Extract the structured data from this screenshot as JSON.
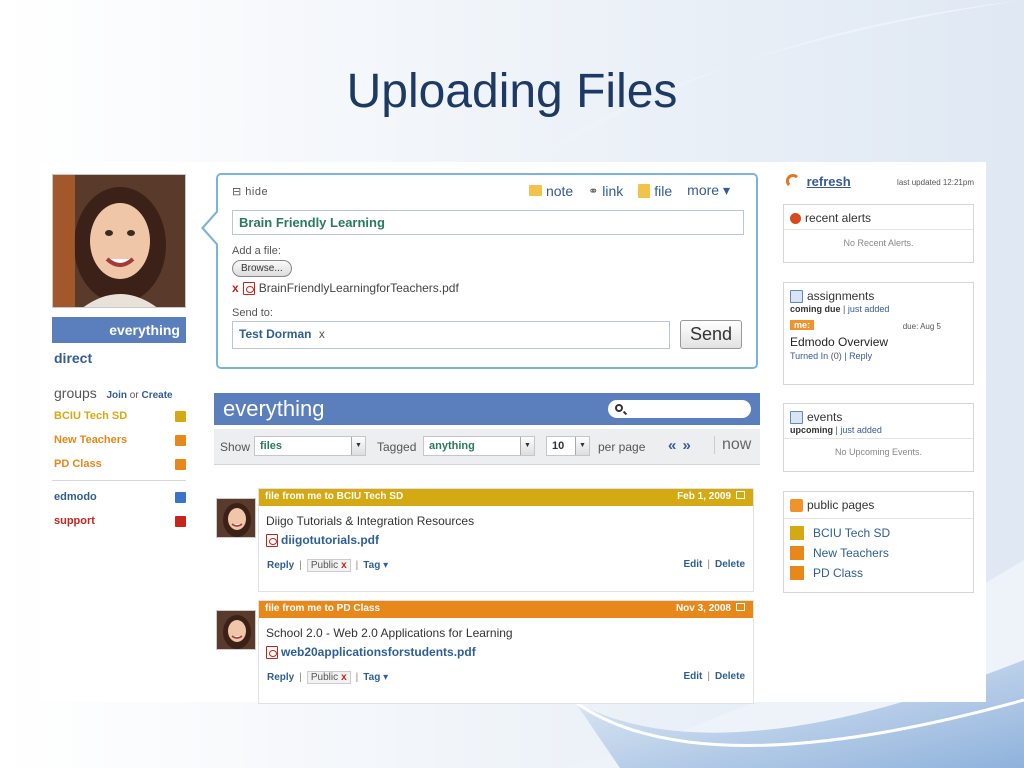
{
  "slide": {
    "title": "Uploading Files"
  },
  "sidebar": {
    "everything_label": "everything",
    "direct_label": "direct",
    "groups_label": "groups",
    "join_label": "Join",
    "or_label": "or",
    "create_label": "Create",
    "groups": [
      {
        "label": "BCIU Tech SD",
        "color": "#d4a913"
      },
      {
        "label": "New Teachers",
        "color": "#e8871a"
      },
      {
        "label": "PD Class",
        "color": "#e8871a"
      }
    ],
    "extras": [
      {
        "label": "edmodo",
        "color": "#2f5e94",
        "icon_color": "#3b73c9"
      },
      {
        "label": "support",
        "color": "#c8241b",
        "icon_color": "#c8241b"
      }
    ]
  },
  "postbox": {
    "hide_label": "⊟ hide",
    "tools": [
      {
        "label": "note",
        "icon": "note-icon",
        "color": "#f2c24b"
      },
      {
        "label": "link",
        "icon": "link-icon",
        "color": "#777777"
      },
      {
        "label": "file",
        "icon": "file-icon",
        "color": "#f2c24b"
      },
      {
        "label": "more ▾",
        "icon": "",
        "color": ""
      }
    ],
    "title_value": "Brain Friendly Learning",
    "add_file_label": "Add a file:",
    "browse_label": "Browse...",
    "attached_file": "BrainFriendlyLearningforTeachers.pdf",
    "send_to_label": "Send to:",
    "recipient": "Test Dorman",
    "recipient_remove": "x",
    "send_label": "Send"
  },
  "feed_header": {
    "title": "everything",
    "filter": {
      "show_label": "Show",
      "show_value": "files",
      "tagged_label": "Tagged",
      "tagged_value": "anything",
      "count_value": "10",
      "per_page_label": "per page",
      "prev_label": "«",
      "next_label": "»",
      "now_label": "now"
    }
  },
  "posts": [
    {
      "header": "file from me to BCIU Tech SD",
      "date": "Feb 1, 2009",
      "header_color": "#d4a913",
      "description": "Diigo Tutorials & Integration Resources",
      "file": "diigotutorials.pdf",
      "reply": "Reply",
      "public": "Public",
      "public_x": "x",
      "tag": "Tag ▾",
      "edit": "Edit",
      "delete": "Delete"
    },
    {
      "header": "file from me to PD Class",
      "date": "Nov 3, 2008",
      "header_color": "#e8871a",
      "description": "School 2.0 - Web 2.0 Applications for Learning",
      "file": "web20applicationsforstudents.pdf",
      "reply": "Reply",
      "public": "Public",
      "public_x": "x",
      "tag": "Tag ▾",
      "edit": "Edit",
      "delete": "Delete"
    }
  ],
  "right": {
    "refresh_label": "refresh",
    "last_updated": "last updated 12:21pm",
    "alerts": {
      "title": "recent alerts",
      "empty": "No Recent Alerts."
    },
    "assignments": {
      "title": "assignments",
      "coming_due": "coming due",
      "just_added": "just added",
      "item": {
        "tag": "me:",
        "due": "due: Aug 5",
        "title": "Edmodo Overview",
        "turned_in": "Turned In",
        "count": "(0)",
        "reply": "Reply"
      }
    },
    "events": {
      "title": "events",
      "upcoming": "upcoming",
      "just_added": "just added",
      "empty": "No Upcoming Events."
    },
    "public_pages": {
      "title": "public pages",
      "items": [
        {
          "label": "BCIU Tech SD",
          "color": "#d4a913"
        },
        {
          "label": "New Teachers",
          "color": "#e8871a"
        },
        {
          "label": "PD Class",
          "color": "#e8871a"
        }
      ]
    }
  }
}
